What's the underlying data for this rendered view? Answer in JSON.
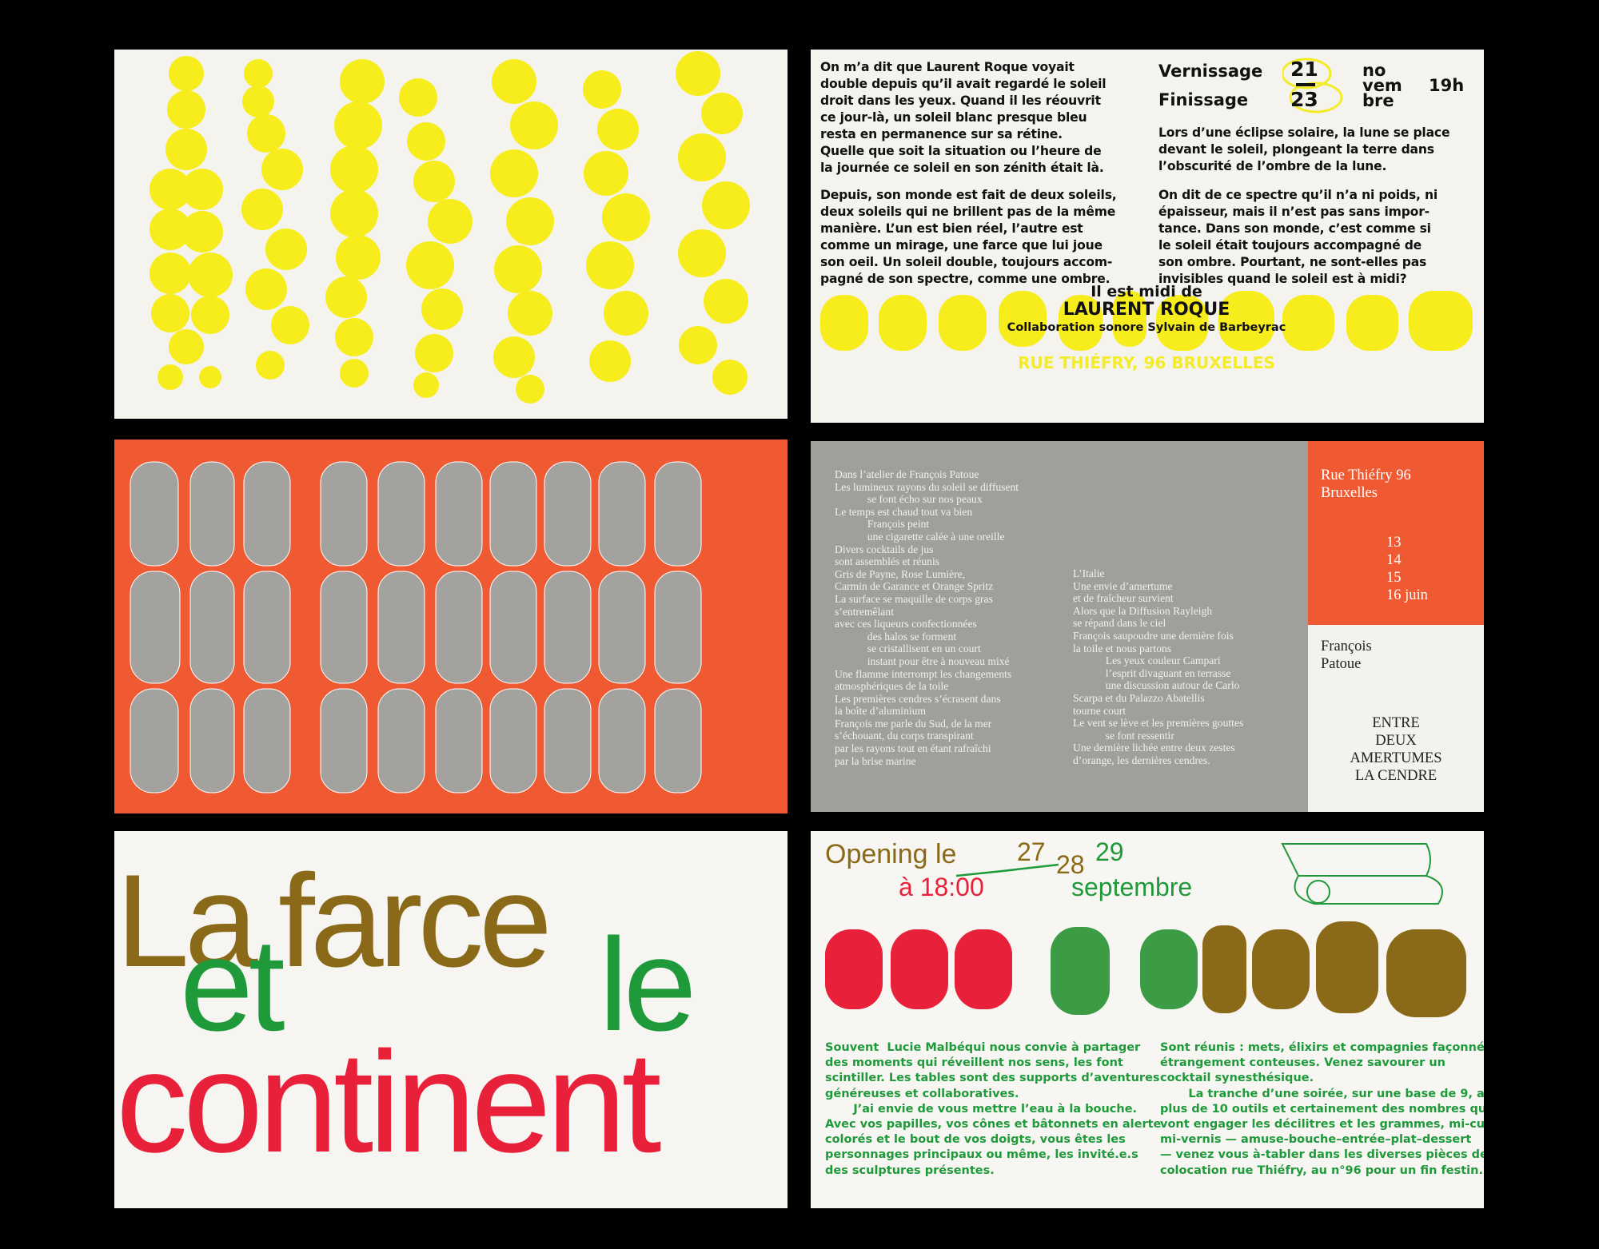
{
  "colors": {
    "yellow": "#f7ec1c",
    "orange": "#f05a32",
    "silver": "#a09f9c",
    "green": "#1f9a3a",
    "red": "#e8203a",
    "olive": "#8a6a18"
  },
  "card2": {
    "vernissage_label": "Vernissage",
    "finissage_label": "Finissage",
    "day_start": "21",
    "day_end": "23",
    "month_top": "no",
    "month_mid": "vem",
    "month_bottom": "bre",
    "time": "19h",
    "para1": "On m’a dit que Laurent Roque voyait\ndouble depuis qu’il avait regardé le soleil\ndroit dans les yeux. Quand il les réouvrit\nce jour-là, un soleil blanc presque bleu\nresta en permanence sur sa rétine.\nQuelle que soit la situation ou l’heure de\nla journée ce soleil en son zénith était là.",
    "para2": "Depuis, son monde est fait de deux soleils,\ndeux soleils qui ne brillent pas de la même\nmanière. L’un est bien réel, l’autre est\ncomme un mirage, une farce que lui joue\nson oeil. Un soleil double, toujours accom-\npagné de son spectre, comme une ombre.",
    "para3": "Lors d’une éclipse solaire, la lune se place\ndevant le soleil, plongeant la terre dans\nl’obscurité de l’ombre de la lune.",
    "para4": "On dit de ce spectre qu’il n’a ni poids, ni\népaisseur, mais il n’est pas sans impor-\ntance. Dans son monde, c’est comme si\nle soleil était toujours accompagné de\nson ombre. Pourtant, ne sont-elles pas\ninvisibles quand le soleil est à midi?",
    "title_line": "Il est midi de",
    "artist": "LAURENT ROQUE",
    "collab": "Collaboration sonore  Sylvain de Barbeyrac",
    "address": "RUE THIÉFRY, 96 BRUXELLES"
  },
  "card4": {
    "poem_left": "Dans l’atelier de François Patoue\nLes lumineux rayons du soleil se diffusent\n            se font écho sur nos peaux\nLe temps est chaud tout va bien\n            François peint\n            une cigarette calée à une oreille\nDivers cocktails de jus\nsont assemblés et réunis\nGris de Payne, Rose Lumière,\nCarmin de Garance et Orange Spritz\nLa surface se maquille de corps gras\ns’entremêlant\navec ces liqueurs confectionnées\n            des halos se forment\n            se cristallisent en un court\n            instant pour être à nouveau mixé\nUne flamme interrompt les changements\natmosphériques de la toile\nLes premières cendres s’écrasent dans\nla boîte d’aluminium\nFrançois me parle du Sud, de la mer\ns’échouant, du corps transpirant\npar les rayons tout en étant rafraîchi\npar la brise marine",
    "poem_right": "L’Italie\nUne envie d’amertume\net de fraîcheur survient\nAlors que la Diffusion Rayleigh\nse répand dans le ciel\nFrançois saupoudre une dernière fois\nla toile et nous partons\n            Les yeux couleur Campari\n            l’esprit divaguant en terrasse\n            une discussion autour de Carlo\nScarpa et du Palazzo Abatellis\ntourne court\nLe vent se lève et les premières gouttes\n            se font ressentir\nUne dernière lichée entre deux zestes\nd’orange, les dernières cendres.",
    "address": "Rue Thiéfry 96\nBruxelles",
    "dates": "13\n14\n15\n16 juin",
    "artist": "François\nPatoue",
    "title": "ENTRE\nDEUX\nAMERTUMES\nLA CENDRE"
  },
  "card5": {
    "w1": "La",
    "w2": "farce",
    "w3": "et",
    "w4": "le",
    "w5": "continent"
  },
  "card6": {
    "opening": "Opening le",
    "d1": "27",
    "d2": "28",
    "d3": "29",
    "time": "à 18:00",
    "month": "septembre",
    "body_left": "Souvent  Lucie Malbéqui nous convie à partager\ndes moments qui réveillent nos sens, les font\nscintiller. Les tables sont des supports d’aventures\ngénéreuses et collaboratives.\n       J’ai envie de vous mettre l’eau à la bouche.\nAvec vos papilles, vos cônes et bâtonnets en alerte\ncolorés et le bout de vos doigts, vous êtes les\npersonnages principaux ou même, les invité.e.s\ndes sculptures présentes.",
    "body_right": "Sont réunis : mets, élixirs et compagnies façonnées,\nétrangement conteuses. Venez savourer un\ncocktail synesthésique.\n       La tranche d’une soirée, sur une base de 9, avec\nplus de 10 outils et certainement des nombres qui\nvont engager les décilitres et les grammes, mi-cuit\nmi-vernis — amuse-bouche–entrée–plat–dessert\n— venez vous à-tabler dans les diverses pièces de la\ncolocation rue Thiéfry, au n°96 pour un fin festin."
  }
}
